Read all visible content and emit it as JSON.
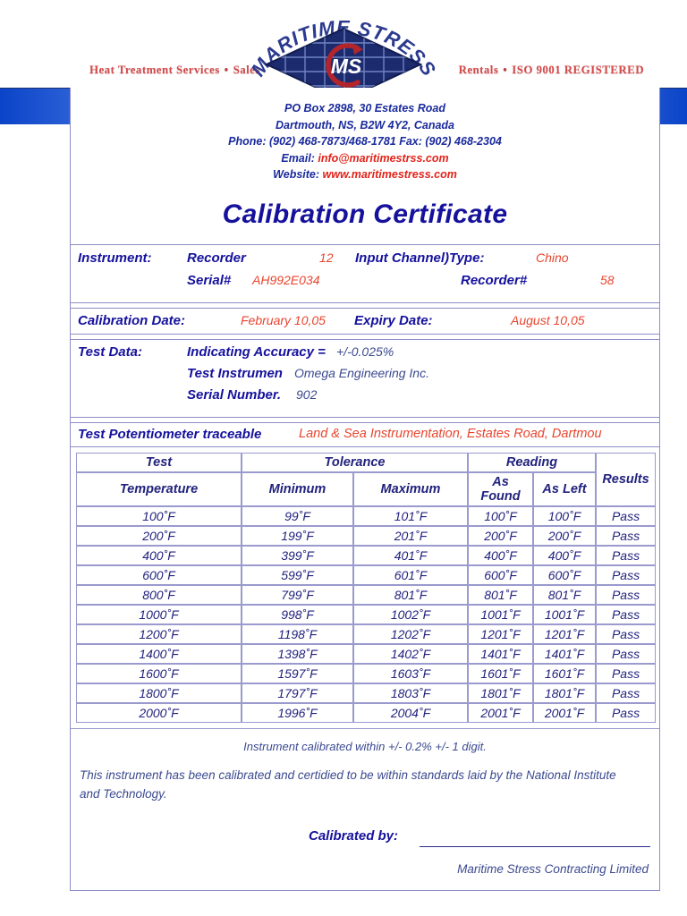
{
  "letterhead": {
    "tagline_left_1": "Heat Treatment Services",
    "tagline_left_sep": "•",
    "tagline_left_2": "Sales",
    "tagline_right_1": "Rentals",
    "tagline_right_sep": "•",
    "tagline_right_2": "ISO 9001 REGISTERED",
    "logo_arc_text": "MARITIME STRESS",
    "logo_monogram": "MS",
    "logo_arc_color": "#2b3a8f",
    "logo_diamond_color": "#1c2a6e",
    "logo_c_color": "#b3252b",
    "tagline_color": "#d44a4a"
  },
  "address": {
    "line1": "PO Box 2898, 30 Estates Road",
    "line2": "Dartmouth, NS, B2W 4Y2, Canada",
    "line3": "Phone: (902) 468-7873/468-1781 Fax: (902) 468-2304",
    "email_label": "Email:",
    "email_value": "info@maritimestrss.com",
    "website_label": "Website:",
    "website_value": "www.maritimestress.com"
  },
  "title": "Calibration Certificate",
  "instrument": {
    "label": "Instrument:",
    "type_label": "Recorder",
    "channel_count": "12",
    "input_channel_label": "Input Channel)Type:",
    "make": "Chino",
    "serial_label": "Serial#",
    "serial_value": "AH992E034",
    "recorder_label": "Recorder#",
    "recorder_value": "58"
  },
  "dates": {
    "calibration_label": "Calibration Date:",
    "calibration_value": "February 10,05",
    "expiry_label": "Expiry Date:",
    "expiry_value": "August 10,05"
  },
  "test_data": {
    "label": "Test Data:",
    "accuracy_label": "Indicating Accuracy =",
    "accuracy_value": "+/-0.025%",
    "instrument_label": "Test Instrumen",
    "instrument_value": "Omega Engineering Inc.",
    "serial_label": "Serial Number.",
    "serial_value": "902"
  },
  "traceability": {
    "label": "Test Potentiometer traceable",
    "value": "Land & Sea Instrumentation, Estates Road, Dartmou"
  },
  "table": {
    "group_headers": [
      "Test",
      "Tolerance",
      "Reading",
      "Results"
    ],
    "sub_headers": [
      "Temperature",
      "Minimum",
      "Maximum",
      "As Found",
      "As Left"
    ],
    "rows": [
      {
        "temperature": "100˚F",
        "minimum": "99˚F",
        "maximum": "101˚F",
        "as_found": "100˚F",
        "as_left": "100˚F",
        "result": "Pass"
      },
      {
        "temperature": "200˚F",
        "minimum": "199˚F",
        "maximum": "201˚F",
        "as_found": "200˚F",
        "as_left": "200˚F",
        "result": "Pass"
      },
      {
        "temperature": "400˚F",
        "minimum": "399˚F",
        "maximum": "401˚F",
        "as_found": "400˚F",
        "as_left": "400˚F",
        "result": "Pass"
      },
      {
        "temperature": "600˚F",
        "minimum": "599˚F",
        "maximum": "601˚F",
        "as_found": "600˚F",
        "as_left": "600˚F",
        "result": "Pass"
      },
      {
        "temperature": "800˚F",
        "minimum": "799˚F",
        "maximum": "801˚F",
        "as_found": "801˚F",
        "as_left": "801˚F",
        "result": "Pass"
      },
      {
        "temperature": "1000˚F",
        "minimum": "998˚F",
        "maximum": "1002˚F",
        "as_found": "1001˚F",
        "as_left": "1001˚F",
        "result": "Pass"
      },
      {
        "temperature": "1200˚F",
        "minimum": "1198˚F",
        "maximum": "1202˚F",
        "as_found": "1201˚F",
        "as_left": "1201˚F",
        "result": "Pass"
      },
      {
        "temperature": "1400˚F",
        "minimum": "1398˚F",
        "maximum": "1402˚F",
        "as_found": "1401˚F",
        "as_left": "1401˚F",
        "result": "Pass"
      },
      {
        "temperature": "1600˚F",
        "minimum": "1597˚F",
        "maximum": "1603˚F",
        "as_found": "1601˚F",
        "as_left": "1601˚F",
        "result": "Pass"
      },
      {
        "temperature": "1800˚F",
        "minimum": "1797˚F",
        "maximum": "1803˚F",
        "as_found": "1801˚F",
        "as_left": "1801˚F",
        "result": "Pass"
      },
      {
        "temperature": "2000˚F",
        "minimum": "1996˚F",
        "maximum": "2004˚F",
        "as_found": "2001˚F",
        "as_left": "2001˚F",
        "result": "Pass"
      }
    ]
  },
  "footer": {
    "note": "Instrument calibrated within +/- 0.2% +/- 1 digit.",
    "statement_line1": "This instrument has been calibrated and certidied to be within standards laid by the National Institute",
    "statement_line2": "and Technology.",
    "calibrated_by_label": "Calibrated by:",
    "company": "Maritime Stress Contracting Limited"
  }
}
